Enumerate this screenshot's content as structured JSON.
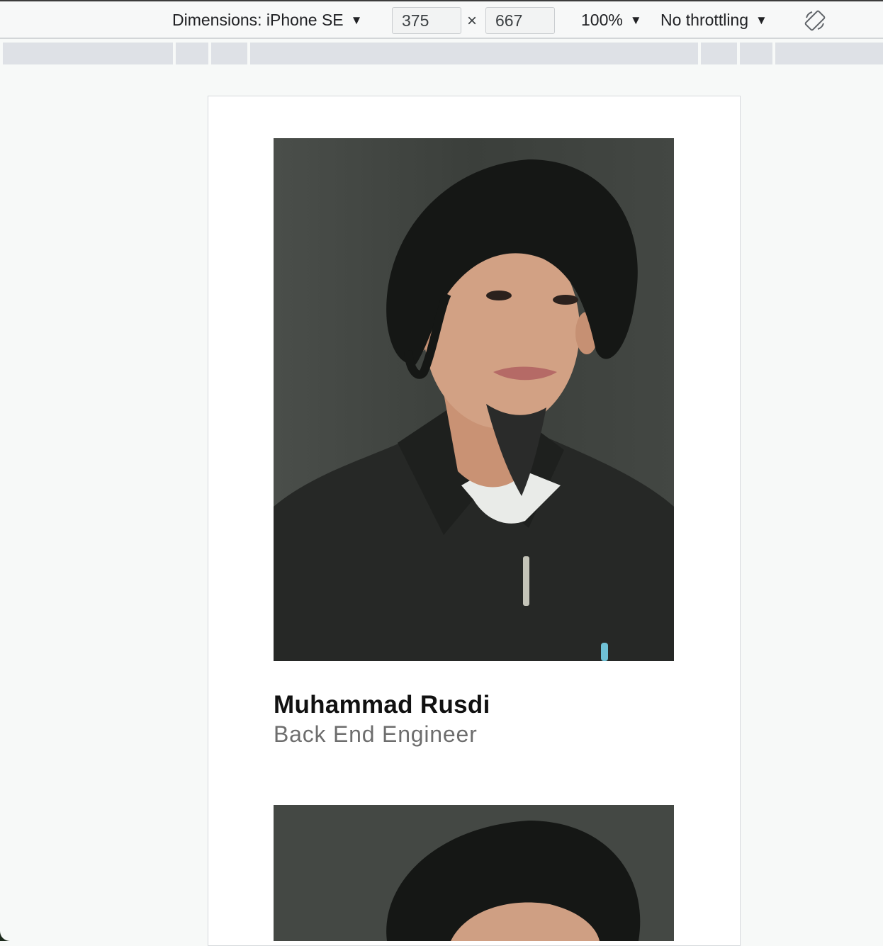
{
  "devtools": {
    "dimensions_label": "Dimensions: iPhone SE",
    "width_value": "375",
    "times_symbol": "×",
    "height_value": "667",
    "zoom_label": "100%",
    "throttle_label": "No throttling",
    "caret": "▼",
    "rotate_icon": "rotate-icon"
  },
  "page": {
    "members": [
      {
        "name": "Muhammad Rusdi",
        "role": "Back End Engineer",
        "photo_alt": "Portrait photo"
      },
      {
        "photo_alt": "Portrait photo"
      }
    ]
  },
  "colors": {
    "background": "#f7f9f8",
    "card": "#ffffff",
    "photo_bg": "#3f423f",
    "name": "#111111",
    "role": "#6d6d6d"
  }
}
